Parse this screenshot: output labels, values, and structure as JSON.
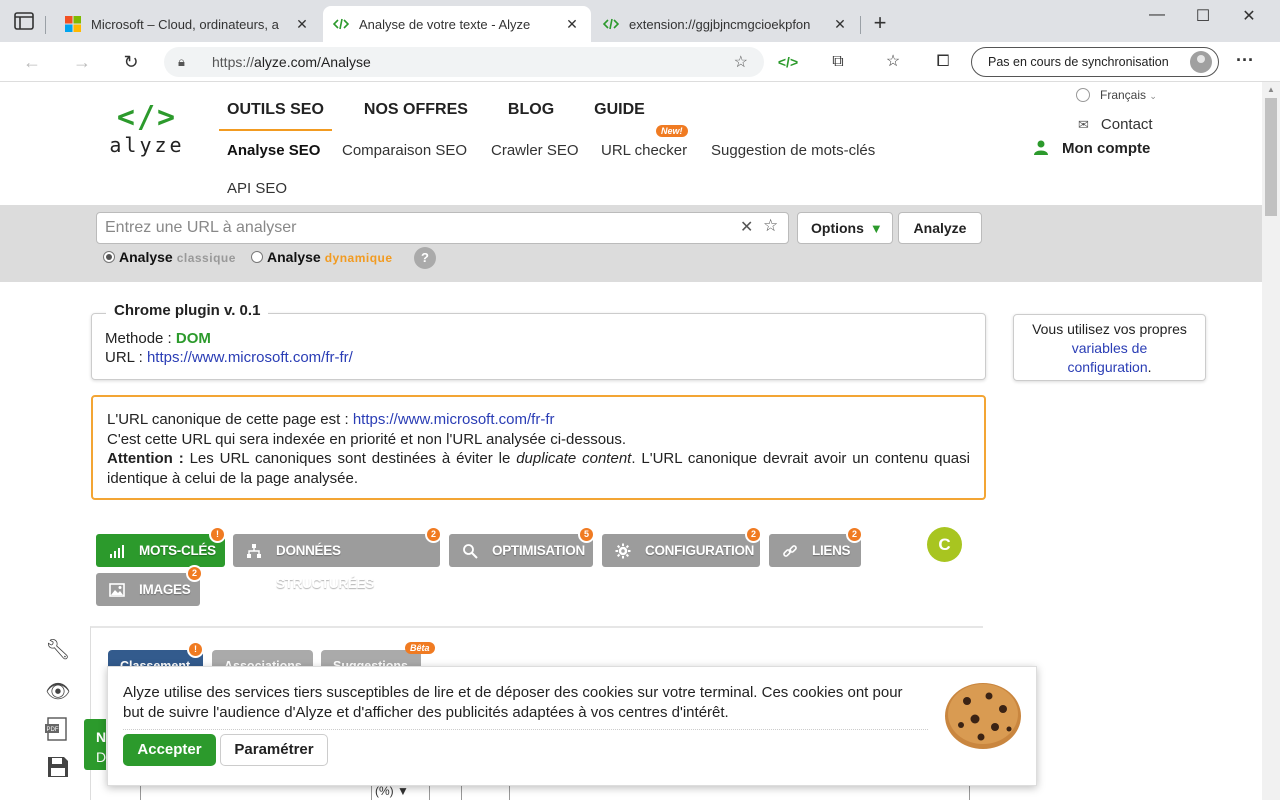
{
  "browser": {
    "tabs": [
      {
        "title": "Microsoft – Cloud, ordinateurs, a",
        "favicon": "microsoft-logo"
      },
      {
        "title": "Analyse de votre texte - Alyze",
        "favicon": "code-icon"
      },
      {
        "title": "extension://ggjbjncmgcioekpfon",
        "favicon": "code-icon"
      }
    ],
    "url_scheme": "https://",
    "url_rest": "alyze.com/Analyse",
    "sync_label": "Pas en cours de synchronisation"
  },
  "site": {
    "logo_symbol": "</>",
    "logo_word": "alyze",
    "nav": [
      "OUTILS SEO",
      "NOS OFFRES",
      "BLOG",
      "GUIDE"
    ],
    "subnav": [
      "Analyse SEO",
      "Comparaison SEO",
      "Crawler SEO",
      "URL checker",
      "Suggestion de mots-clés",
      "API SEO"
    ],
    "new_badge": "New!",
    "language": "Français",
    "contact": "Contact",
    "account": "Mon compte"
  },
  "search": {
    "placeholder": "Entrez une URL à analyser",
    "options_label": "Options",
    "analyze_label": "Analyze",
    "mode1_bold": "Analyse",
    "mode1_suffix": "classique",
    "mode2_bold": "Analyse",
    "mode2_suffix": "dynamique",
    "help": "?"
  },
  "plugin": {
    "legend": "Chrome plugin v. 0.1",
    "method_label": "Methode : ",
    "method_value": "DOM",
    "url_label": "URL : ",
    "url_value": "https://www.microsoft.com/fr-fr/"
  },
  "sidebox": {
    "text_before": "Vous utilisez vos propres",
    "link": "variables de configuration",
    "text_after": "."
  },
  "canonical": {
    "line1": "L'URL canonique de cette page est : ",
    "url": "https://www.microsoft.com/fr-fr",
    "line2": "C'est cette URL qui sera indexée en priorité et non l'URL analysée ci-dessous.",
    "attention_label": "Attention :",
    "attention_text1": " Les URL canoniques sont destinées à éviter le ",
    "attention_em": "duplicate content",
    "attention_text2": ". L'URL canonique devrait avoir un contenu quasi identique à celui de la page analysée."
  },
  "categories": [
    {
      "label": "MOTS-CLÉS",
      "count": "!",
      "color": "#2c9a2c"
    },
    {
      "label": "DONNÉES STRUCTURÉES",
      "count": "2",
      "color": "#9c9c9c"
    },
    {
      "label": "OPTIMISATION",
      "count": "5",
      "color": "#9c9c9c"
    },
    {
      "label": "CONFIGURATION",
      "count": "2",
      "color": "#9c9c9c"
    },
    {
      "label": "LIENS",
      "count": "2",
      "color": "#9c9c9c"
    },
    {
      "label": "IMAGES",
      "count": "2",
      "color": "#9c9c9c"
    }
  ],
  "grade": "C",
  "subtabs": [
    {
      "label": "Classement",
      "badge": "!"
    },
    {
      "label": "Associations",
      "badge": ""
    },
    {
      "label": "Suggestions",
      "badge": "Bêta"
    }
  ],
  "left_flag": {
    "l1": "N",
    "l2": "D"
  },
  "table_peek": "(%) ▼",
  "cookie": {
    "text": "Alyze utilise des services tiers susceptibles de lire et de déposer des cookies sur votre terminal. Ces cookies ont pour but de suivre l'audience d'Alyze et d'afficher des publicités adaptées à vos centres d'intérêt.",
    "accept": "Accepter",
    "settings": "Paramétrer"
  },
  "colors": {
    "brand_green": "#2c9a2c",
    "accent_orange": "#f29b21",
    "link_blue": "#2a3db5"
  }
}
